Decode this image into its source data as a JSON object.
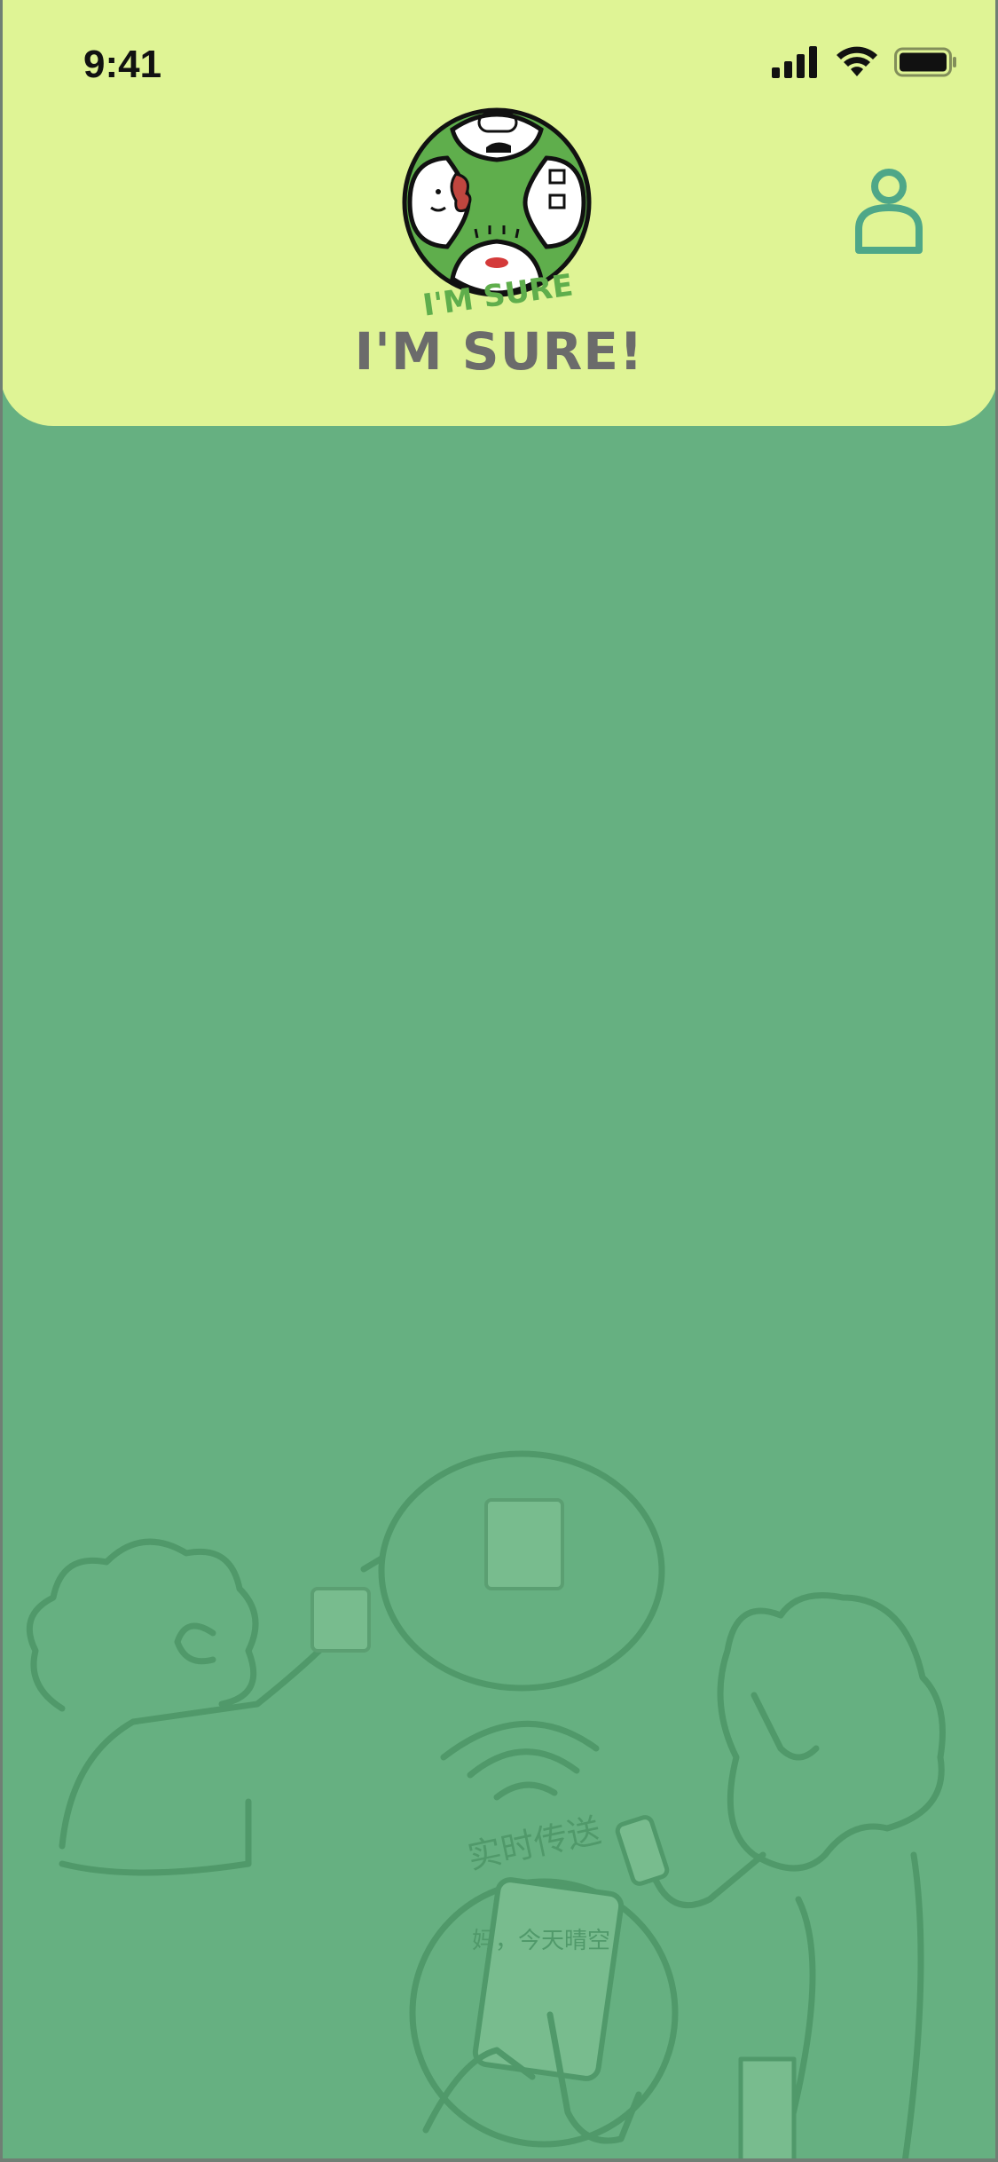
{
  "status_bar": {
    "time": "9:41",
    "icons": [
      "signal-icon",
      "wifi-icon",
      "battery-icon"
    ]
  },
  "header": {
    "app_title": "I'M SURE!",
    "logo_text": "I'M SURE",
    "profile_icon": "user-icon"
  },
  "illustration": {
    "caption": "实时传送",
    "phone_text": "妈，今天晴空"
  },
  "colors": {
    "header_bg": "#dff495",
    "body_bg": "#66b081",
    "accent_teal": "#4ea788",
    "title_gray": "#6b6b6b"
  }
}
